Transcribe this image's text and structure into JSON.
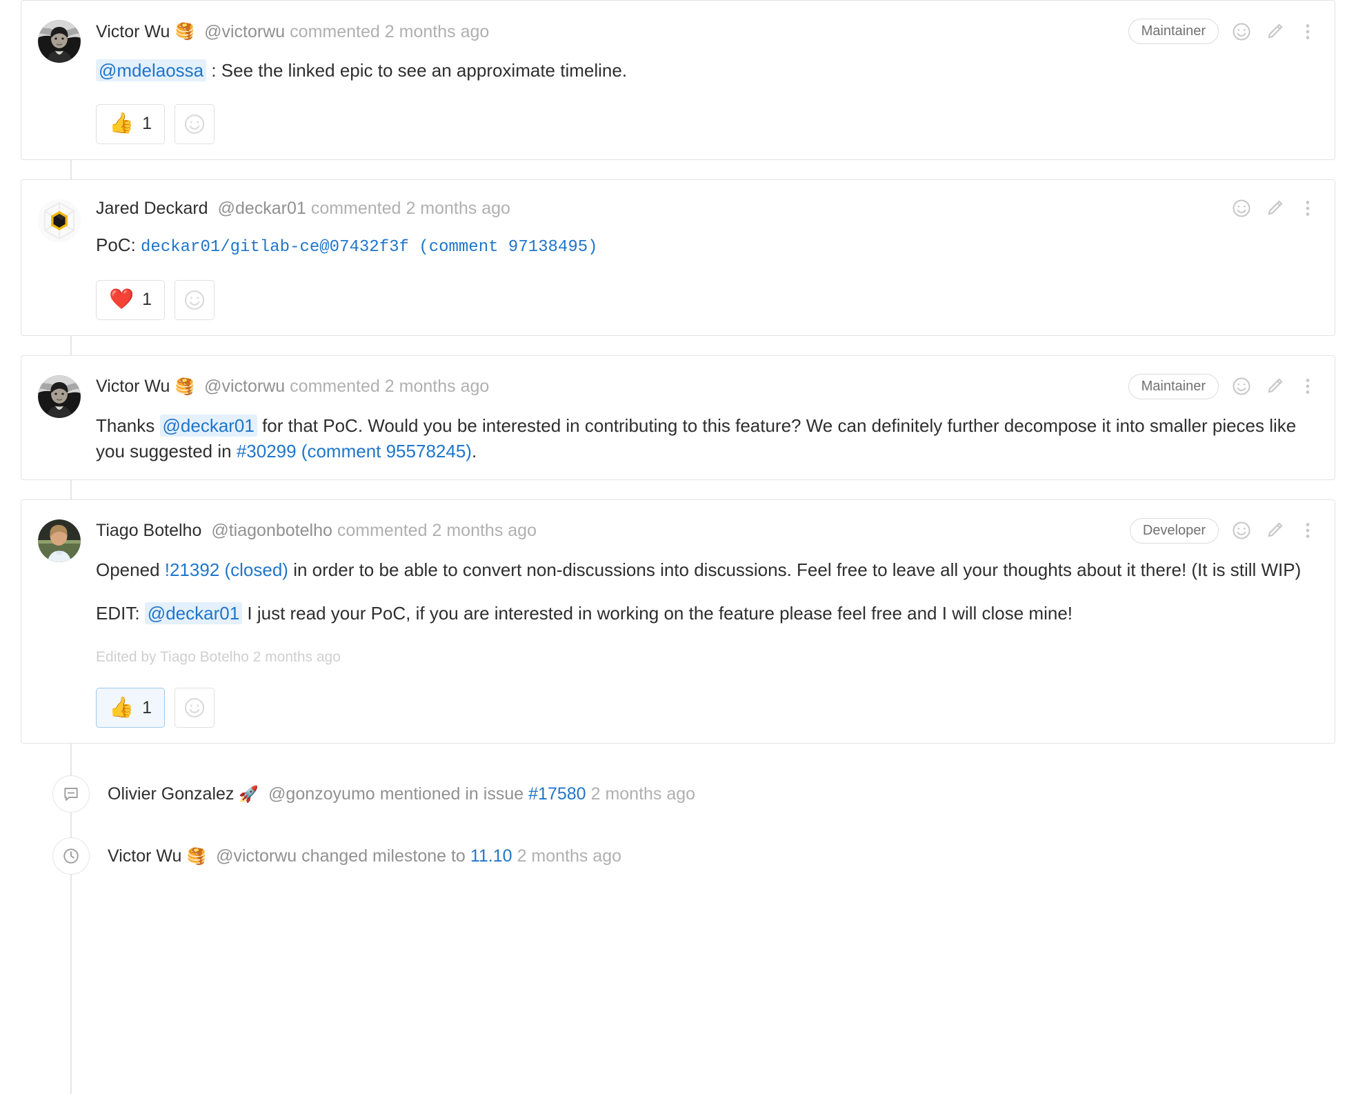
{
  "colors": {
    "link": "#1f75cb",
    "mention_bg": "#e4f0fb",
    "card_border": "#e3e3e3",
    "muted": "#919191",
    "active_reaction_border": "#9ec9f0"
  },
  "comments": [
    {
      "author": "Victor Wu",
      "author_emoji": "🥞",
      "handle": "@victorwu",
      "action": "commented",
      "time": "2 months ago",
      "role_badge": "Maintainer",
      "avatar_type": "photo-victor",
      "paragraphs": [
        [
          {
            "type": "mention",
            "text": "@mdelaossa"
          },
          {
            "type": "plain",
            "text": " : See the linked epic to see an approximate timeline."
          }
        ]
      ],
      "edited_note": null,
      "reactions": [
        {
          "emoji": "👍",
          "count": "1",
          "active": false
        }
      ],
      "add_reaction": true
    },
    {
      "author": "Jared Deckard",
      "author_emoji": "",
      "handle": "@deckar01",
      "action": "commented",
      "time": "2 months ago",
      "role_badge": null,
      "avatar_type": "hex-logo",
      "paragraphs": [
        [
          {
            "type": "plain",
            "text": "PoC: "
          },
          {
            "type": "mono-link",
            "text": "deckar01/gitlab-ce@07432f3f (comment 97138495)"
          }
        ]
      ],
      "edited_note": null,
      "reactions": [
        {
          "emoji": "❤️",
          "count": "1",
          "active": false
        }
      ],
      "add_reaction": true
    },
    {
      "author": "Victor Wu",
      "author_emoji": "🥞",
      "handle": "@victorwu",
      "action": "commented",
      "time": "2 months ago",
      "role_badge": "Maintainer",
      "avatar_type": "photo-victor",
      "paragraphs": [
        [
          {
            "type": "plain",
            "text": "Thanks "
          },
          {
            "type": "mention",
            "text": "@deckar01"
          },
          {
            "type": "plain",
            "text": " for that PoC. Would you be interested in contributing to this feature? We can definitely further decompose it into smaller pieces like you suggested in "
          },
          {
            "type": "link",
            "text": "#30299 (comment 95578245)"
          },
          {
            "type": "plain",
            "text": "."
          }
        ]
      ],
      "edited_note": null,
      "reactions": [],
      "add_reaction": false
    },
    {
      "author": "Tiago Botelho",
      "author_emoji": "",
      "handle": "@tiagonbotelho",
      "action": "commented",
      "time": "2 months ago",
      "role_badge": "Developer",
      "avatar_type": "photo-tiago",
      "paragraphs": [
        [
          {
            "type": "plain",
            "text": "Opened "
          },
          {
            "type": "link",
            "text": "!21392 (closed)"
          },
          {
            "type": "plain",
            "text": " in order to be able to convert non-discussions into discussions. Feel free to leave all your thoughts about it there! (It is still WIP)"
          }
        ],
        [
          {
            "type": "plain",
            "text": "EDIT: "
          },
          {
            "type": "mention",
            "text": "@deckar01"
          },
          {
            "type": "plain",
            "text": " I just read your PoC, if you are interested in working on the feature please feel free and I will close mine!"
          }
        ]
      ],
      "edited_note": "Edited by Tiago Botelho 2 months ago",
      "reactions": [
        {
          "emoji": "👍",
          "count": "1",
          "active": true
        }
      ],
      "add_reaction": true
    }
  ],
  "events": [
    {
      "icon": "comment-bubble-icon",
      "author": "Olivier Gonzalez",
      "author_emoji": "🚀",
      "handle": "@gonzoyumo",
      "middle": "mentioned in issue",
      "link": "#17580",
      "time": "2 months ago"
    },
    {
      "icon": "clock-icon",
      "author": "Victor Wu",
      "author_emoji": "🥞",
      "handle": "@victorwu",
      "middle": "changed milestone to",
      "link": "11.10",
      "time": "2 months ago"
    }
  ],
  "icons": {
    "emoji_add": "smiley-icon",
    "edit": "pencil-icon",
    "more": "vertical-dots-icon"
  }
}
